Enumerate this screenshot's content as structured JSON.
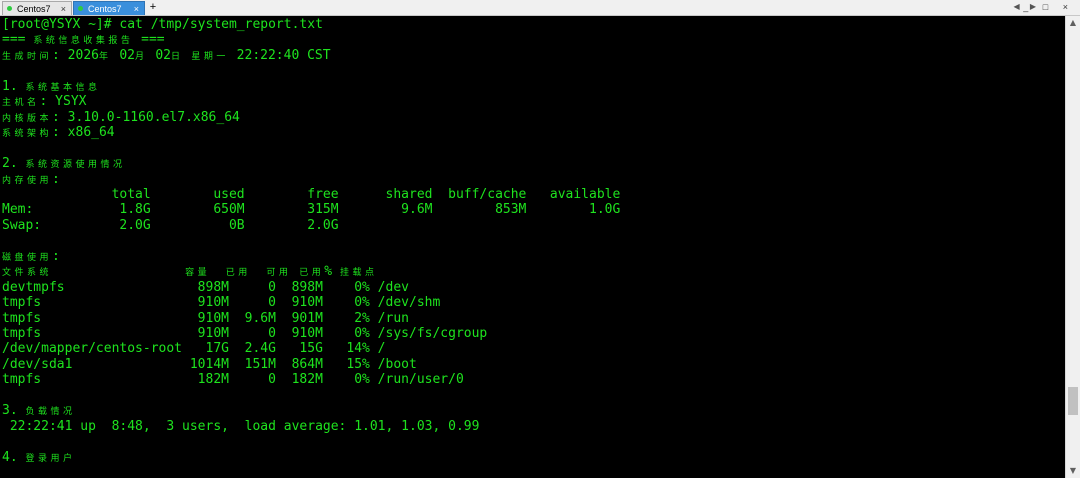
{
  "tabs": [
    {
      "label": "Centos7",
      "close": "×",
      "dot_color": "#2ecc40"
    },
    {
      "label": "Centos7",
      "close": "×",
      "dot_color": "#2ecc40",
      "active": true
    }
  ],
  "tab_add": "+",
  "window_controls": "_ □ ×",
  "tab_scroll": "◀ ▶",
  "scrollbar": {
    "up": "▲",
    "down": "▼",
    "position": 0.88
  },
  "terminal": {
    "color": "#1ee31e",
    "lines": [
      "[root@YSYX ~]# cat /tmp/system_report.txt",
      "=== 系统信息收集报告 ===",
      "生成时间: 2026年 02月 02日 星期一 22:22:40 CST",
      "",
      "1. 系统基本信息",
      "主机名: YSYX",
      "内核版本: 3.10.0-1160.el7.x86_64",
      "系统架构: x86_64",
      "",
      "2. 系统资源使用情况",
      "内存使用:",
      "              total        used        free      shared  buff/cache   available",
      "Mem:           1.8G        650M        315M        9.6M        853M        1.0G",
      "Swap:          2.0G          0B        2.0G",
      "",
      "磁盘使用:",
      "文件系统                 容量  已用  可用 已用% 挂载点",
      "devtmpfs                 898M     0  898M    0% /dev",
      "tmpfs                    910M     0  910M    0% /dev/shm",
      "tmpfs                    910M  9.6M  901M    2% /run",
      "tmpfs                    910M     0  910M    0% /sys/fs/cgroup",
      "/dev/mapper/centos-root   17G  2.4G   15G   14% /",
      "/dev/sda1               1014M  151M  864M   15% /boot",
      "tmpfs                    182M     0  182M    0% /run/user/0",
      "",
      "3. 负载情况",
      " 22:22:41 up  8:48,  3 users,  load average: 1.01, 1.03, 0.99",
      "",
      "4. 登录用户"
    ]
  }
}
